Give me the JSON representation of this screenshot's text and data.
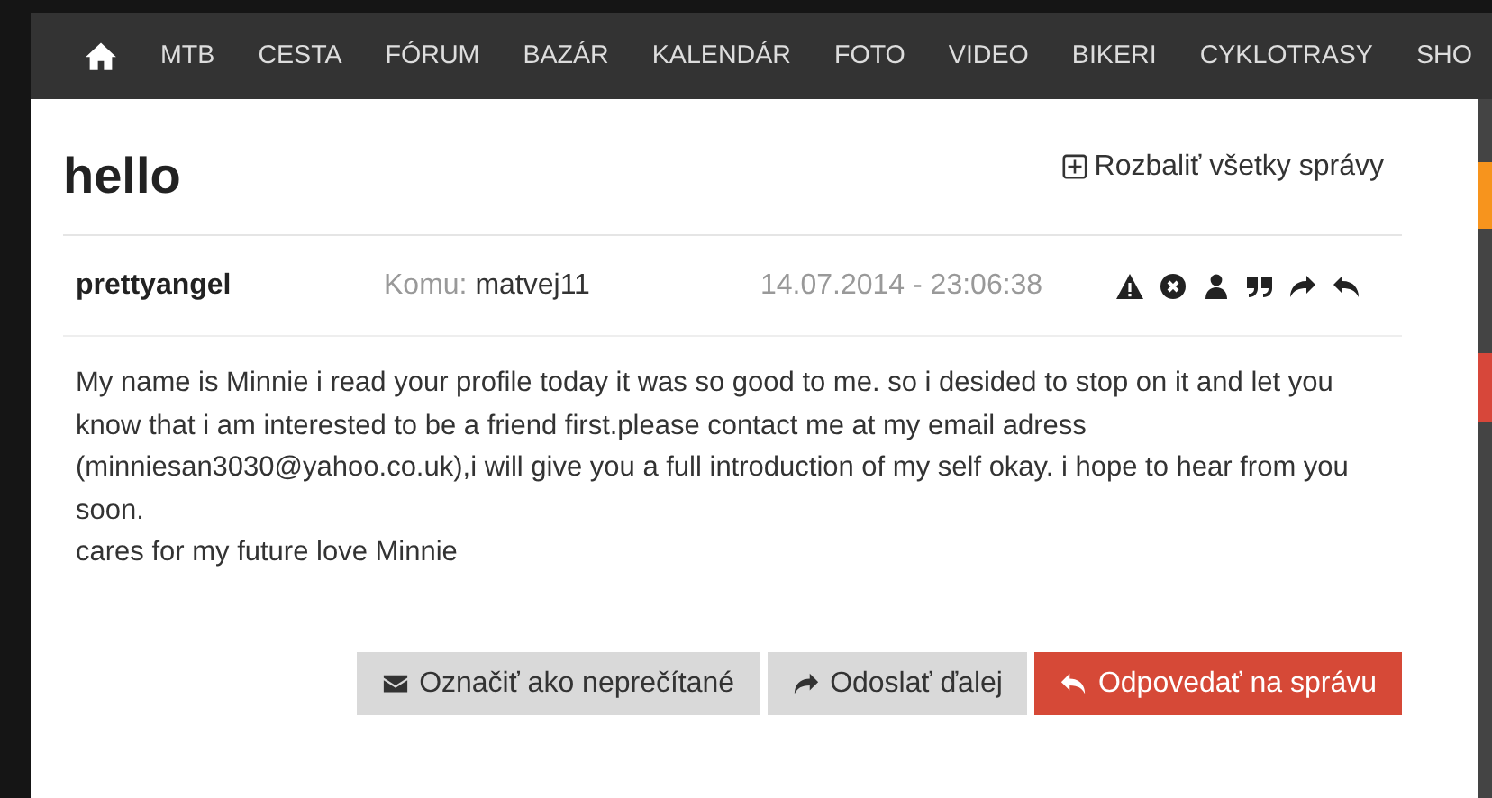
{
  "nav": {
    "items": [
      "MTB",
      "CESTA",
      "FÓRUM",
      "BAZÁR",
      "KALENDÁR",
      "FOTO",
      "VIDEO",
      "BIKERI",
      "CYKLOTRASY",
      "SHO"
    ]
  },
  "thread": {
    "title": "hello",
    "expand_all": "Rozbaliť všetky správy"
  },
  "message": {
    "sender": "prettyangel",
    "to_label": "Komu:",
    "recipient": "matvej11",
    "date": "14.07.2014 - 23:06:38",
    "body": [
      "My name is Minnie i read your profile today it was so good to me. so i desided to stop on it and let you know that i am interested to be a friend first.please contact me at my email adress (minniesan3030@yahoo.co.uk),i will give you a full introduction of my self okay. i hope to hear from you soon.",
      "cares for my future love Minnie"
    ]
  },
  "buttons": [
    {
      "label": "Označiť ako neprečítané",
      "kind": "default"
    },
    {
      "label": "Odoslať ďalej",
      "kind": "default"
    },
    {
      "label": "Odpovedať na správu",
      "kind": "primary"
    }
  ]
}
